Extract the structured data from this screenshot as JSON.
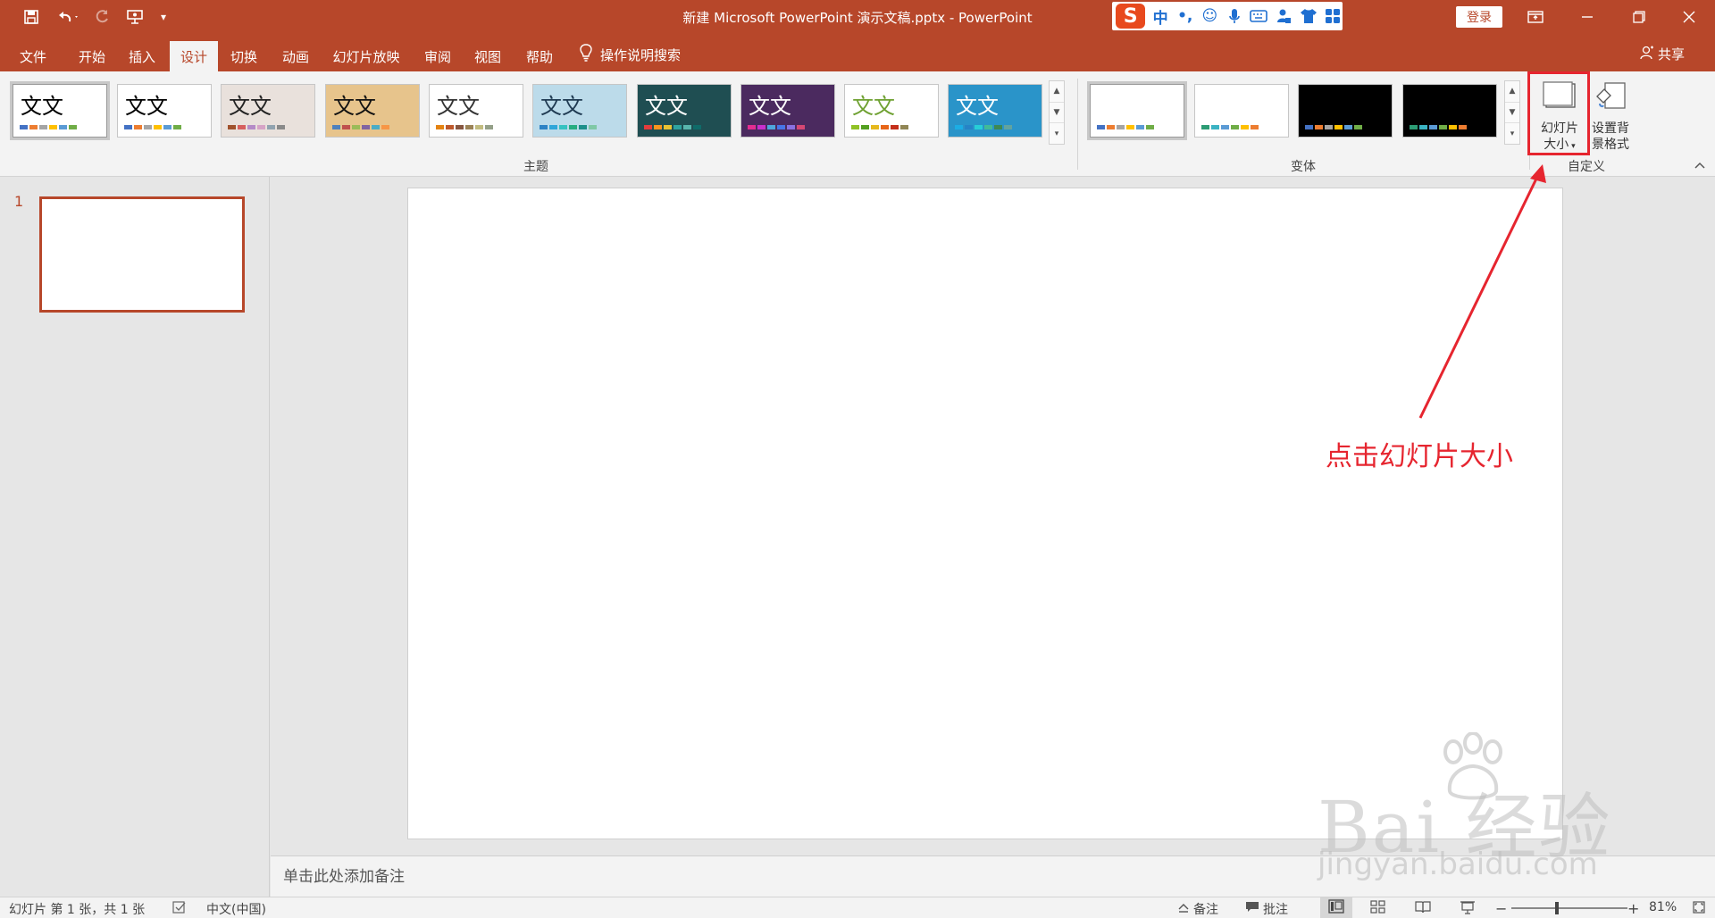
{
  "window": {
    "title": "新建 Microsoft PowerPoint 演示文稿.pptx  -  PowerPoint",
    "login": "登录",
    "share": "共享"
  },
  "ime": {
    "logo": "S",
    "mode": "中",
    "punct": "•,"
  },
  "tabs": [
    {
      "label": "文件"
    },
    {
      "label": "开始"
    },
    {
      "label": "插入"
    },
    {
      "label": "设计"
    },
    {
      "label": "切换"
    },
    {
      "label": "动画"
    },
    {
      "label": "幻灯片放映"
    },
    {
      "label": "审阅"
    },
    {
      "label": "视图"
    },
    {
      "label": "帮助"
    }
  ],
  "tell_me": "操作说明搜索",
  "ribbon": {
    "themes_label": "主题",
    "variants_label": "变体",
    "customize_label": "自定义",
    "theme_sample_text": "文文",
    "slide_size": {
      "line1": "幻灯片",
      "line2": "大小"
    },
    "format_background": {
      "line1": "设置背",
      "line2": "景格式"
    }
  },
  "theme_colors": [
    {
      "bg": "#ffffff",
      "text": "#000000",
      "bars": [
        "#4472c4",
        "#ed7d31",
        "#a5a5a5",
        "#ffc000",
        "#5b9bd5",
        "#70ad47"
      ]
    },
    {
      "bg": "#ffffff",
      "text": "#000000",
      "bars": [
        "#4472c4",
        "#ed7d31",
        "#a5a5a5",
        "#ffc000",
        "#5b9bd5",
        "#70ad47"
      ]
    },
    {
      "bg": "#e9e1dc",
      "text": "#222222",
      "bars": [
        "#a0522d",
        "#d65f5f",
        "#b58bc7",
        "#d6a3c6",
        "#91a3b0",
        "#8a8a8a"
      ]
    },
    {
      "bg": "#e7c48c",
      "text": "#111111",
      "bars": [
        "#4f81bd",
        "#c0504d",
        "#9bbb59",
        "#8064a2",
        "#4bacc6",
        "#f79646"
      ]
    },
    {
      "bg": "#ffffff",
      "text": "#333333",
      "bars": [
        "#e48312",
        "#bd582c",
        "#865640",
        "#9b8357",
        "#c2bc80",
        "#94a088"
      ]
    },
    {
      "bg": "#bcdbea",
      "text": "#1f3a52",
      "bars": [
        "#2e83c5",
        "#30a6d9",
        "#35c2c1",
        "#27ad81",
        "#1d8f8a",
        "#7fc8a6"
      ]
    },
    {
      "bg": "#1f4e52",
      "text": "#ffffff",
      "bars": [
        "#e43c3c",
        "#f7941e",
        "#e8c233",
        "#2ea3a0",
        "#58b6ad",
        "#0f6b69"
      ]
    },
    {
      "bg": "#4b2a5f",
      "text": "#ffffff",
      "bars": [
        "#e32d91",
        "#c830cc",
        "#4ea6dc",
        "#4775e7",
        "#8971e1",
        "#d54773"
      ]
    },
    {
      "bg": "#ffffff",
      "text": "#6fa132",
      "bars": [
        "#90c226",
        "#54a021",
        "#e6b91e",
        "#e76618",
        "#c42f1a",
        "#918655"
      ]
    },
    {
      "bg": "#2a94c9",
      "text": "#ffffff",
      "bars": [
        "#1cade4",
        "#2683c6",
        "#27ced7",
        "#42ba97",
        "#3e8853",
        "#62a39f"
      ]
    }
  ],
  "variant_colors": [
    {
      "bg": "#ffffff",
      "bars": [
        "#4472c4",
        "#ed7d31",
        "#a5a5a5",
        "#ffc000",
        "#5b9bd5",
        "#70ad47"
      ]
    },
    {
      "bg": "#ffffff",
      "bars": [
        "#2c9c74",
        "#3bb3c3",
        "#5b9bd5",
        "#70ad47",
        "#ffc000",
        "#ed7d31"
      ]
    },
    {
      "bg": "#000000",
      "bars": [
        "#4472c4",
        "#ed7d31",
        "#a5a5a5",
        "#ffc000",
        "#5b9bd5",
        "#70ad47"
      ]
    },
    {
      "bg": "#000000",
      "bars": [
        "#2c9c74",
        "#3bb3c3",
        "#5b9bd5",
        "#70ad47",
        "#ffc000",
        "#ed7d31"
      ]
    }
  ],
  "slides": {
    "number": "1"
  },
  "notes_placeholder": "单击此处添加备注",
  "status": {
    "slide_info": "幻灯片 第 1 张，共 1 张",
    "language": "中文(中国)",
    "notes": "备注",
    "comments": "批注",
    "zoom_level": "81%",
    "zoom_fraction": 0.81
  },
  "annotation": {
    "text": "点击幻灯片大小"
  },
  "watermark": {
    "main": "Bai 经验",
    "url": "jingyan.baidu.com"
  },
  "colors": {
    "accent": "#b7472a",
    "annotation": "#e6252f"
  }
}
